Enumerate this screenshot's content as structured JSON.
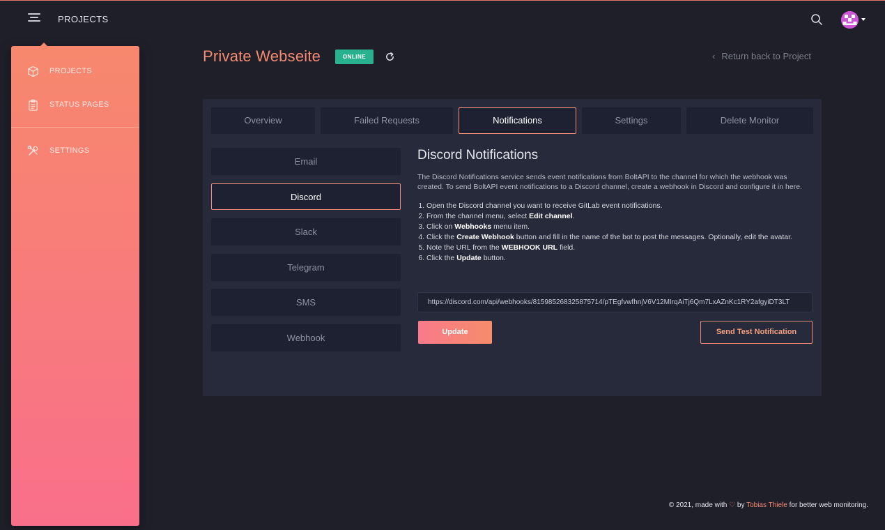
{
  "topbar": {
    "title": "PROJECTS",
    "menu_icon": "hamburger-menu-icon",
    "search_icon": "search-icon",
    "avatar_icon": "user-avatar-icon"
  },
  "sidebar": {
    "items": [
      {
        "label": "PROJECTS",
        "icon": "box-icon"
      },
      {
        "label": "STATUS PAGES",
        "icon": "clipboard-icon"
      },
      {
        "label": "SETTINGS",
        "icon": "tools-icon"
      }
    ]
  },
  "header": {
    "title": "Private Webseite",
    "status": "ONLINE",
    "refresh_icon": "refresh-icon",
    "return_link": "Return back to Project"
  },
  "tabs": [
    {
      "label": "Overview",
      "active": false
    },
    {
      "label": "Failed Requests",
      "active": false
    },
    {
      "label": "Notifications",
      "active": true
    },
    {
      "label": "Settings",
      "active": false
    },
    {
      "label": "Delete Monitor",
      "active": false
    }
  ],
  "services": [
    {
      "label": "Email",
      "active": false
    },
    {
      "label": "Discord",
      "active": true
    },
    {
      "label": "Slack",
      "active": false
    },
    {
      "label": "Telegram",
      "active": false
    },
    {
      "label": "SMS",
      "active": false
    },
    {
      "label": "Webhook",
      "active": false
    }
  ],
  "content": {
    "title": "Discord Notifications",
    "description": "The Discord Notifications service sends event notifications from BoltAPI to the channel for which the webhook was created. To send BoltAPI event notifications to a Discord channel, create a webhook in Discord and configure it in here.",
    "steps": [
      {
        "pre": "Open the Discord channel you want to receive GitLab event notifications.",
        "bold": "",
        "post": ""
      },
      {
        "pre": "From the channel menu, select ",
        "bold": "Edit channel",
        "post": "."
      },
      {
        "pre": "Click on ",
        "bold": "Webhooks",
        "post": " menu item."
      },
      {
        "pre": "Click the ",
        "bold": "Create Webhook",
        "post": " button and fill in the name of the bot to post the messages. Optionally, edit the avatar."
      },
      {
        "pre": "Note the URL from the ",
        "bold": "WEBHOOK URL",
        "post": " field."
      },
      {
        "pre": "Click the ",
        "bold": "Update",
        "post": " button."
      }
    ],
    "webhook_url": "https://discord.com/api/webhooks/815985268325875714/pTEgfvwfhnjV6V12MIrqAiTj6Qm7LxAZnKc1RY2afgyiDT3LT",
    "update_button": "Update",
    "test_button": "Send Test Notification"
  },
  "footer": {
    "prefix": "© 2021, made with",
    "by": "by",
    "author": "Tobias Thiele",
    "suffix": "for better web monitoring."
  },
  "colors": {
    "accent": "#f58a70",
    "status_online": "#27b18e",
    "background": "#1e1f29",
    "panel": "#272a3a"
  }
}
